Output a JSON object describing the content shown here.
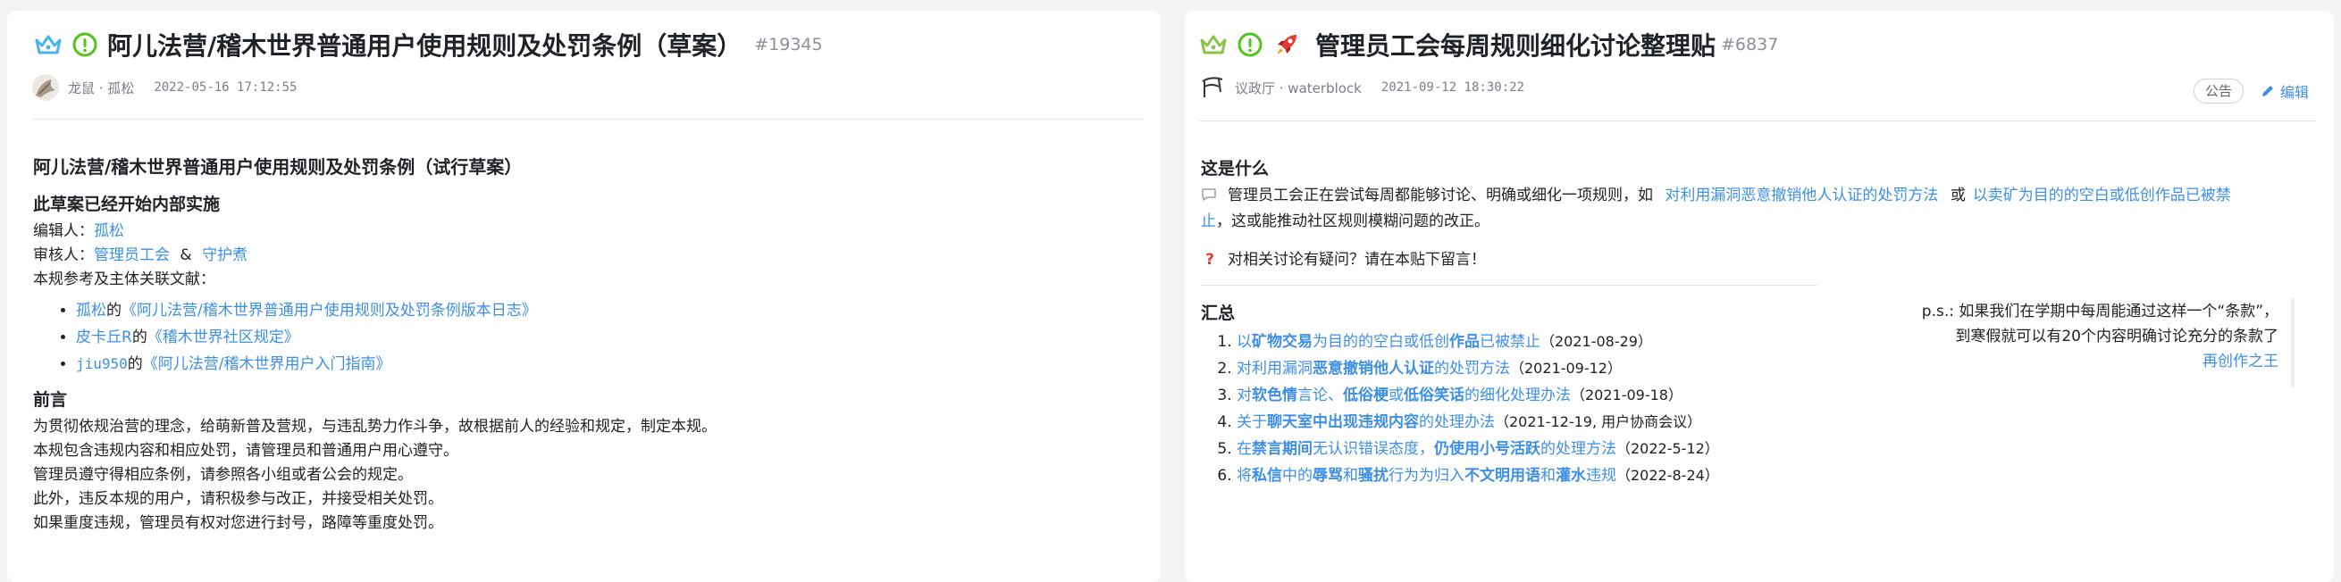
{
  "left": {
    "title": "阿儿法营/稽木世界普通用户使用规则及处罚条例（草案）",
    "id": "#19345",
    "author": "龙鼠 · 孤松",
    "time": "2022-05-16 17:12:55",
    "doc_title": "阿儿法营/稽木世界普通用户使用规则及处罚条例（试行草案）",
    "status_heading": "此草案已经开始内部实施",
    "editor_label": "编辑人：",
    "editor": "孤松",
    "reviewer_label": "审核人：",
    "reviewer1": "管理员工会",
    "amp": "&",
    "reviewer2": "守护煮",
    "refs_intro": "本规参考及主体关联文献：",
    "refs": [
      {
        "user": "孤松",
        "of": "的",
        "doc": "《阿儿法营/稽木世界普通用户使用规则及处罚条例版本日志》"
      },
      {
        "user": "皮卡丘R",
        "of": "的",
        "doc": "《稽木世界社区规定》"
      },
      {
        "user": "jiu950",
        "of": "的",
        "doc": "《阿儿法营/稽木世界用户入门指南》"
      }
    ],
    "preface_heading": "前言",
    "preface": [
      "为贯彻依规治营的理念，给萌新普及营规，与违乱势力作斗争，故根据前人的经验和规定，制定本规。",
      "本规包含违规内容和相应处罚，请管理员和普通用户用心遵守。",
      "管理员遵守得相应条例，请参照各小组或者公会的规定。",
      "此外，违反本规的用户，请积极参与改正，并接受相关处罚。",
      "如果重度违规，管理员有权对您进行封号，路障等重度处罚。"
    ]
  },
  "right": {
    "title": "管理员工会每周规则细化讨论整理贴",
    "id": "#6837",
    "author": "议政厅 · waterblock",
    "time": "2021-09-12 18:30:22",
    "tag": "公告",
    "edit": "编辑",
    "what_heading": "这是什么",
    "what_p1_pre": "管理员工会正在尝试每周都能够讨论、明确或细化一项规则，如",
    "what_link1": "对利用漏洞恶意撤销他人认证的处罚方法",
    "what_or": "或",
    "what_link2a": "以卖矿为目的的空白或低创作品已被禁",
    "what_link2b": "止",
    "what_p1_post": "，这或能推动社区规则模糊问题的改正。",
    "question": "对相关讨论有疑问？请在本贴下留言！",
    "summary_heading": "汇总",
    "ps_line1": "p.s.: 如果我们在学期中每周能通过这样一个“条款”，",
    "ps_line2": "到寒假就可以有20个内容明确讨论充分的条款了",
    "ps_link": "再创作之王",
    "summary": [
      {
        "parts": [
          {
            "t": "以",
            "b": false
          },
          {
            "t": "矿物交易",
            "b": true
          },
          {
            "t": "为目的的空白或低创",
            "b": false
          },
          {
            "t": "作品",
            "b": true
          },
          {
            "t": "已被禁止",
            "b": false
          }
        ],
        "date": "（2021-08-29）"
      },
      {
        "parts": [
          {
            "t": "对利用漏洞",
            "b": false
          },
          {
            "t": "恶意撤销他人认证",
            "b": true
          },
          {
            "t": "的处罚方法",
            "b": false
          }
        ],
        "date": "（2021-09-12）"
      },
      {
        "parts": [
          {
            "t": "对",
            "b": false
          },
          {
            "t": "软色情",
            "b": true
          },
          {
            "t": "言论、",
            "b": false
          },
          {
            "t": "低俗梗",
            "b": true
          },
          {
            "t": "或",
            "b": false
          },
          {
            "t": "低俗笑话",
            "b": true
          },
          {
            "t": "的细化处理办法",
            "b": false
          }
        ],
        "date": "（2021-09-18）"
      },
      {
        "parts": [
          {
            "t": "关于",
            "b": false
          },
          {
            "t": "聊天室中出现违规内容",
            "b": true
          },
          {
            "t": "的处理办法",
            "b": false
          }
        ],
        "date": "（2021-12-19, 用户协商会议）"
      },
      {
        "parts": [
          {
            "t": "在",
            "b": false
          },
          {
            "t": "禁言期间",
            "b": true
          },
          {
            "t": "无认识错误态度，",
            "b": false
          },
          {
            "t": "仍使用小号活跃",
            "b": true
          },
          {
            "t": "的处理方法",
            "b": false
          }
        ],
        "date": "（2022-5-12）"
      },
      {
        "parts": [
          {
            "t": "将",
            "b": false
          },
          {
            "t": "私信",
            "b": true
          },
          {
            "t": "中的",
            "b": false
          },
          {
            "t": "辱骂",
            "b": true
          },
          {
            "t": "和",
            "b": false
          },
          {
            "t": "骚扰",
            "b": true
          },
          {
            "t": "行为为归入",
            "b": false
          },
          {
            "t": "不文明用语",
            "b": true
          },
          {
            "t": "和",
            "b": false
          },
          {
            "t": "灌水",
            "b": true
          },
          {
            "t": "违规",
            "b": false
          }
        ],
        "date": "（2022-8-24）"
      }
    ]
  },
  "icons": {
    "crown": "crown-icon",
    "alert": "exclamation-circle-icon",
    "rocket": "rocket-icon",
    "pencil": "pencil-icon",
    "speech": "speech-bubble-icon",
    "question": "question-mark-icon"
  },
  "colors": {
    "link": "#3d8fe6",
    "crown_left": "#46b6ea",
    "crown_right": "#8bc34a",
    "alert": "#52c41a",
    "question": "#e53935"
  }
}
